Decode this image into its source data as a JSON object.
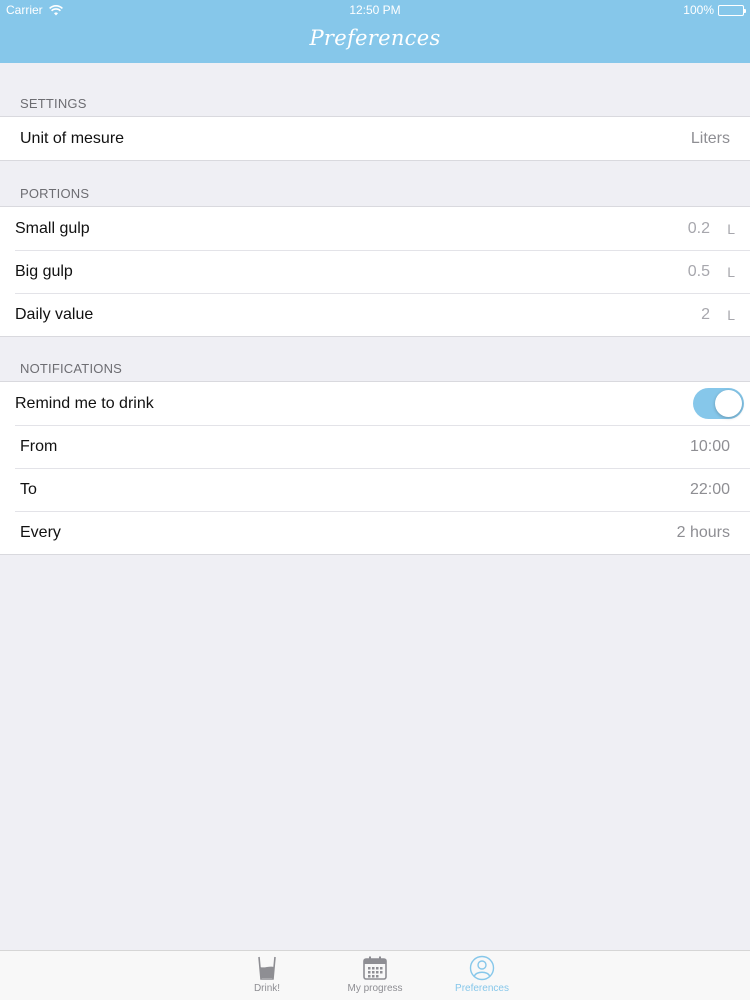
{
  "status": {
    "carrier": "Carrier",
    "time": "12:50 PM",
    "battery": "100%"
  },
  "nav": {
    "title": "Preferences",
    "accent_color": "#86c7ea"
  },
  "settings": {
    "header": "SETTINGS",
    "unit_label": "Unit of mesure",
    "unit_value": "Liters"
  },
  "portions": {
    "header": "PORTIONS",
    "items": [
      {
        "label": "Small gulp",
        "value": "0.2",
        "unit": "L"
      },
      {
        "label": "Big gulp",
        "value": "0.5",
        "unit": "L"
      },
      {
        "label": "Daily value",
        "value": "2",
        "unit": "L"
      }
    ]
  },
  "notifications": {
    "header": "NOTIFICATIONS",
    "remind_label": "Remind me to drink",
    "remind_enabled": true,
    "from_label": "From",
    "from_value": "10:00",
    "to_label": "To",
    "to_value": "22:00",
    "every_label": "Every",
    "every_value": "2 hours"
  },
  "tabs": [
    {
      "label": "Drink!",
      "icon": "glass-icon",
      "active": false
    },
    {
      "label": "My progress",
      "icon": "calendar-icon",
      "active": false
    },
    {
      "label": "Preferences",
      "icon": "user-icon",
      "active": true
    }
  ]
}
